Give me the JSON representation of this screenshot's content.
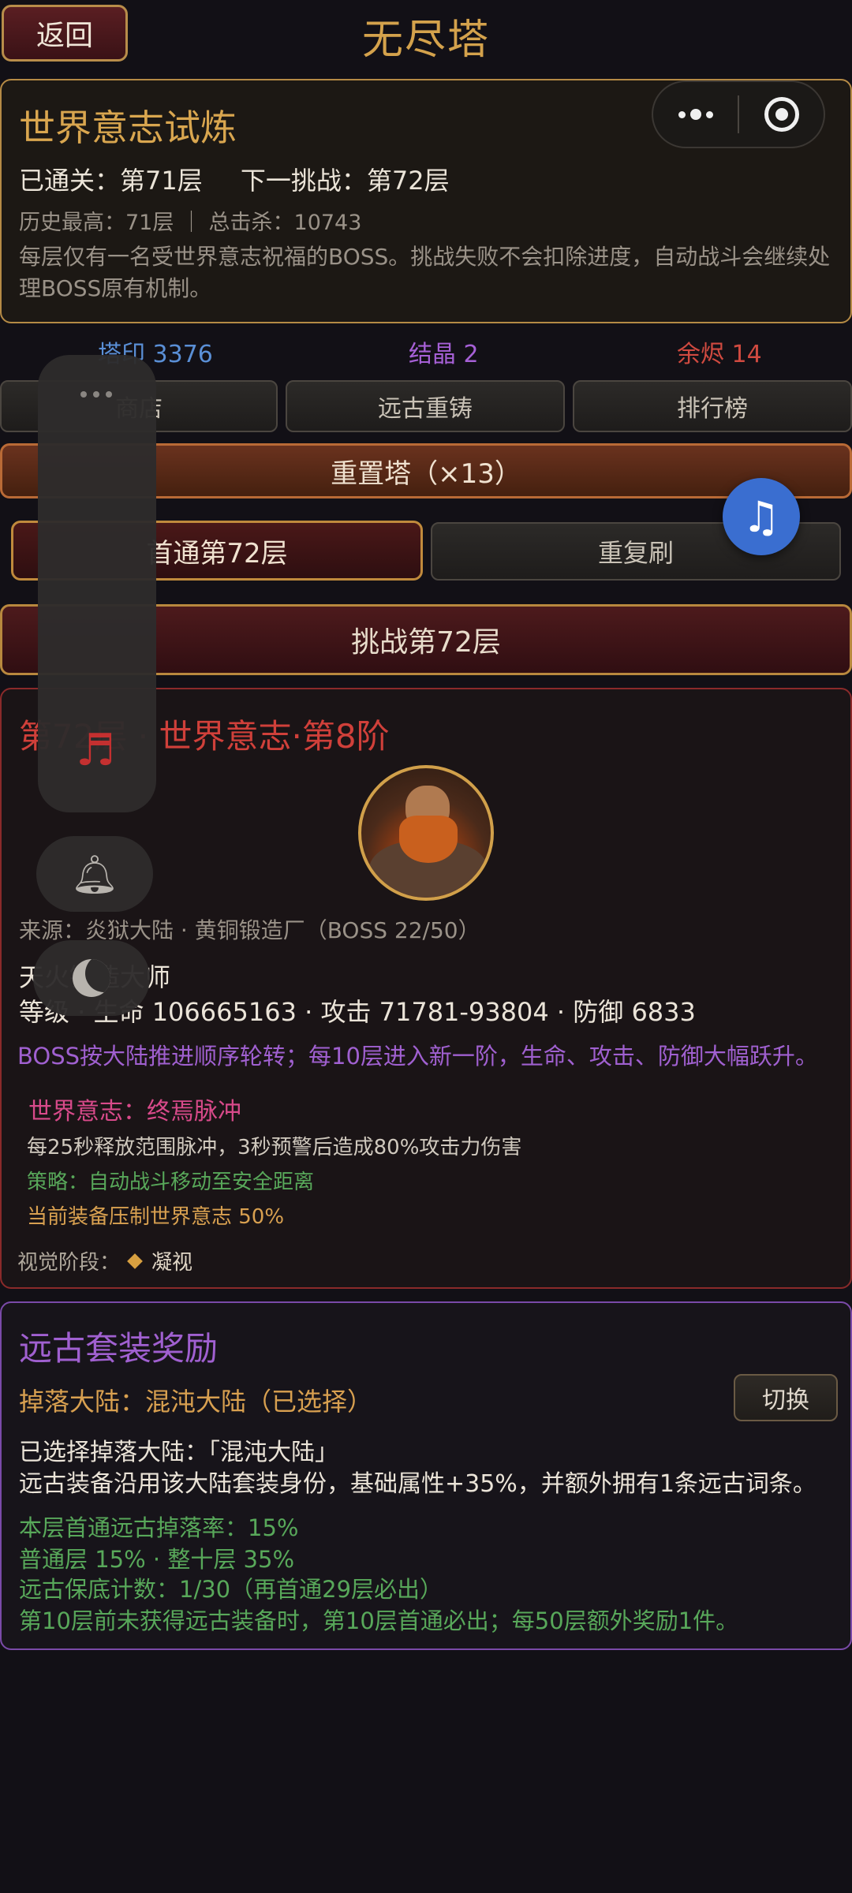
{
  "header": {
    "back_label": "返回",
    "title": "无尽塔"
  },
  "trial": {
    "title": "世界意志试炼",
    "cleared": "已通关：第71层",
    "next": "下一挑战：第72层",
    "history": "历史最高：71层 ｜ 总击杀：10743",
    "desc": "每层仅有一名受世界意志祝福的BOSS。挑战失败不会扣除进度，自动战斗会继续处理BOSS原有机制。"
  },
  "currency": {
    "seal": "塔印 3376",
    "crystal": "结晶 2",
    "ember": "余烬 14"
  },
  "actions": {
    "shop": "商店",
    "reforge": "远古重铸",
    "rank": "排行榜",
    "reset": "重置塔（×13）",
    "first_clear": "首通第72层",
    "repeat": "重复刷",
    "challenge": "挑战第72层"
  },
  "boss": {
    "title": "第72层 · 世界意志·第8阶",
    "source": "来源：炎狱大陆 · 黄铜锻造厂（BOSS 22/50）",
    "name": "天火锻造大师",
    "stats": "等级 ·  生命 106665163 · 攻击 71781-93804 · 防御 6833",
    "rotation": "BOSS按大陆推进顺序轮转；每10层进入新一阶，生命、攻击、防御大幅跃升。",
    "will_title": "世界意志：终焉脉冲",
    "will_desc": "每25秒释放范围脉冲，3秒预警后造成80%攻击力伤害",
    "strategy": "策略：自动战斗移动至安全距离",
    "suppress": "当前装备压制世界意志 50%",
    "visual_label": "视觉阶段：",
    "visual_value": "凝视"
  },
  "reward": {
    "title": "远古套装奖励",
    "drop": "掉落大陆：混沌大陆（已选择）",
    "switch_label": "切换",
    "selected": "已选择掉落大陆：「混沌大陆」",
    "desc": "远古装备沿用该大陆套装身份，基础属性+35%，并额外拥有1条远古词条。",
    "rate": "本层首通远古掉落率：15%",
    "rates": "普通层 15% · 整十层 35%",
    "pity": "远古保底计数：1/30（再首通29层必出）",
    "note": "第10层前未获得远古装备时，第10层首通必出；每50层额外奖励1件。"
  },
  "icons": {
    "more": "more-dots-icon",
    "close": "target-close-icon",
    "music": "music-note-icon",
    "bell": "bell-icon",
    "moon": "moon-icon"
  },
  "colors": {
    "gold": "#d4a24c",
    "seal": "#5a8fd6",
    "crystal": "#a660d6",
    "ember": "#d04a40",
    "boss_red": "#d0403a",
    "green": "#58a85a",
    "purple": "#a060d0"
  }
}
